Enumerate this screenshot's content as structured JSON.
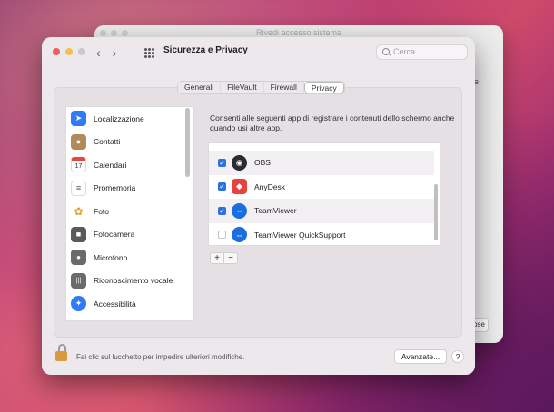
{
  "back_window": {
    "title": "Rivedi accesso sistema",
    "right_text": "e",
    "button_label": "ose"
  },
  "window": {
    "title": "Sicurezza e Privacy",
    "nav_back": "‹",
    "nav_forward": "›"
  },
  "search": {
    "placeholder": "Cerca"
  },
  "tabs": [
    {
      "label": "Generali",
      "active": false
    },
    {
      "label": "FileVault",
      "active": false
    },
    {
      "label": "Firewall",
      "active": false
    },
    {
      "label": "Privacy",
      "active": true
    }
  ],
  "sidebar": {
    "items": [
      {
        "label": "Localizzazione",
        "icon": "location-arrow-icon",
        "color": "#2f7cf6",
        "glyph": "➤"
      },
      {
        "label": "Contatti",
        "icon": "contacts-icon",
        "color": "#b08a5a",
        "glyph": "●"
      },
      {
        "label": "Calendari",
        "icon": "calendar-icon",
        "color": "#ffffff",
        "glyph": "17"
      },
      {
        "label": "Promemoria",
        "icon": "reminders-icon",
        "color": "#ffffff",
        "glyph": "≡"
      },
      {
        "label": "Foto",
        "icon": "photos-icon",
        "color": "#ffffff",
        "glyph": "✿"
      },
      {
        "label": "Fotocamera",
        "icon": "camera-icon",
        "color": "#5a5a5a",
        "glyph": "■"
      },
      {
        "label": "Microfono",
        "icon": "microphone-icon",
        "color": "#6a6a6a",
        "glyph": "🎙"
      },
      {
        "label": "Riconoscimento vocale",
        "icon": "speech-recognition-icon",
        "color": "#6a6a6a",
        "glyph": "|||"
      },
      {
        "label": "Accessibilità",
        "icon": "accessibility-icon",
        "color": "#2f7cf6",
        "glyph": "♿"
      }
    ]
  },
  "description": "Consenti alle seguenti app di registrare i contenuti dello schermo anche quando usi altre app.",
  "apps": [
    {
      "name": "OBS",
      "checked": true,
      "icon": "obs-icon",
      "color": "#2b2b30",
      "glyph": "◉"
    },
    {
      "name": "AnyDesk",
      "checked": true,
      "icon": "anydesk-icon",
      "color": "#e9413b",
      "glyph": "◆"
    },
    {
      "name": "TeamViewer",
      "checked": true,
      "icon": "teamviewer-icon",
      "color": "#1a6fe0",
      "glyph": "⇔"
    },
    {
      "name": "TeamViewer QuickSupport",
      "checked": false,
      "icon": "teamviewer-quicksupport-icon",
      "color": "#1a6fe0",
      "glyph": "⇔"
    }
  ],
  "controls": {
    "add": "+",
    "remove": "−"
  },
  "footer": {
    "lock_text": "Fai clic sul lucchetto per impedire ulteriori modifiche.",
    "advanced_label": "Avanzate...",
    "help_label": "?"
  }
}
